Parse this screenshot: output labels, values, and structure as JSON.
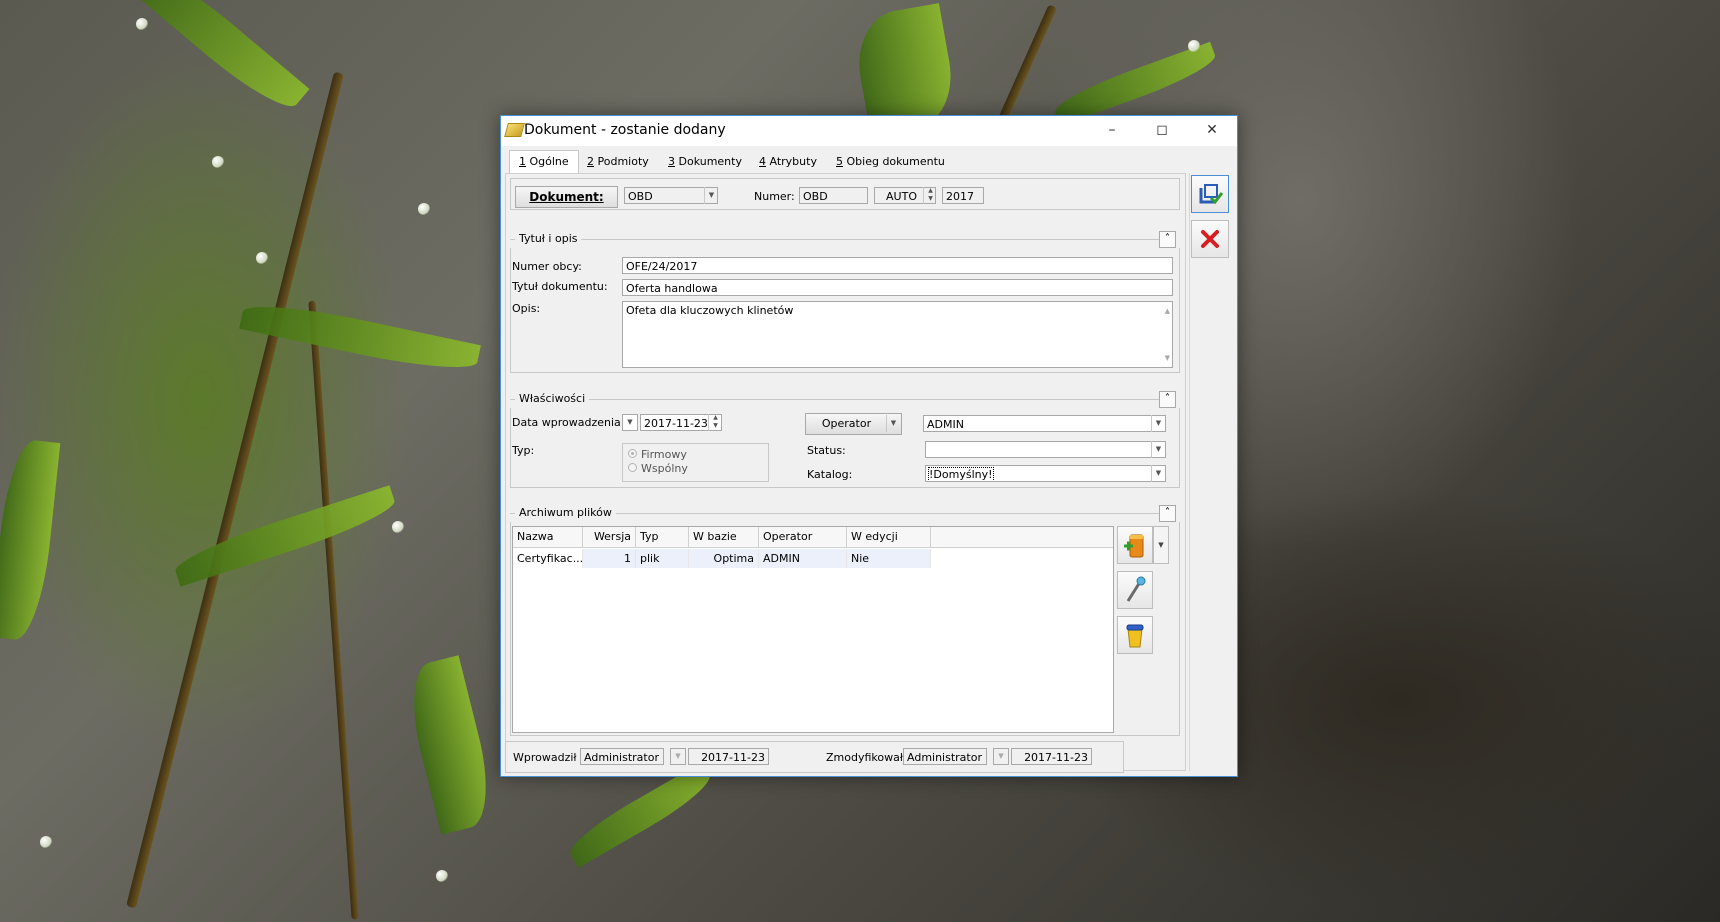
{
  "window": {
    "title": "Dokument - zostanie dodany"
  },
  "tabs": [
    {
      "key": "1",
      "label": " Ogólne"
    },
    {
      "key": "2",
      "label": " Podmioty"
    },
    {
      "key": "3",
      "label": " Dokumenty"
    },
    {
      "key": "4",
      "label": " Atrybuty"
    },
    {
      "key": "5",
      "label": " Obieg dokumentu"
    }
  ],
  "header": {
    "dokument_button": "Dokument:",
    "dokument_value": "OBD",
    "numer_label": "Numer:",
    "numer_prefix": "OBD",
    "numer_auto": "AUTO",
    "numer_year": "2017"
  },
  "section_tytul": {
    "title": "Tytuł i opis",
    "numer_obcy_label": "Numer obcy:",
    "numer_obcy_value": "OFE/24/2017",
    "tytul_label": "Tytuł dokumentu:",
    "tytul_value": "Oferta handlowa",
    "opis_label": "Opis:",
    "opis_value": "Ofeta dla kluczowych klinetów"
  },
  "section_wlasciwosci": {
    "title": "Właściwości",
    "data_label": "Data wprowadzenia:",
    "data_value": "2017-11-23",
    "typ_label": "Typ:",
    "typ_options": [
      "Firmowy",
      "Wspólny"
    ],
    "operator_button": "Operator",
    "operator_value": "ADMIN",
    "status_label": "Status:",
    "status_value": "",
    "katalog_label": "Katalog:",
    "katalog_value": "!Domyślny!"
  },
  "section_archiwum": {
    "title": "Archiwum plików",
    "columns": [
      "Nazwa",
      "Wersja",
      "Typ",
      "W bazie",
      "Operator",
      "W edycji"
    ],
    "rows": [
      [
        "Certyfikac...",
        "1",
        "plik",
        "Optima",
        "ADMIN",
        "Nie"
      ]
    ]
  },
  "footer": {
    "wprowadzil_label": "Wprowadził",
    "wprowadzil_value": "Administrator",
    "wprowadzil_date": "2017-11-23",
    "zmodyfikowal_label": "Zmodyfikował:",
    "zmodyfikowal_value": "Administrator",
    "zmodyfikowal_date": "2017-11-23"
  },
  "icons": {
    "save": "save-icon",
    "cancel": "close-red-icon",
    "add_file": "add-file-icon",
    "edit": "pen-icon",
    "delete": "trash-icon"
  }
}
